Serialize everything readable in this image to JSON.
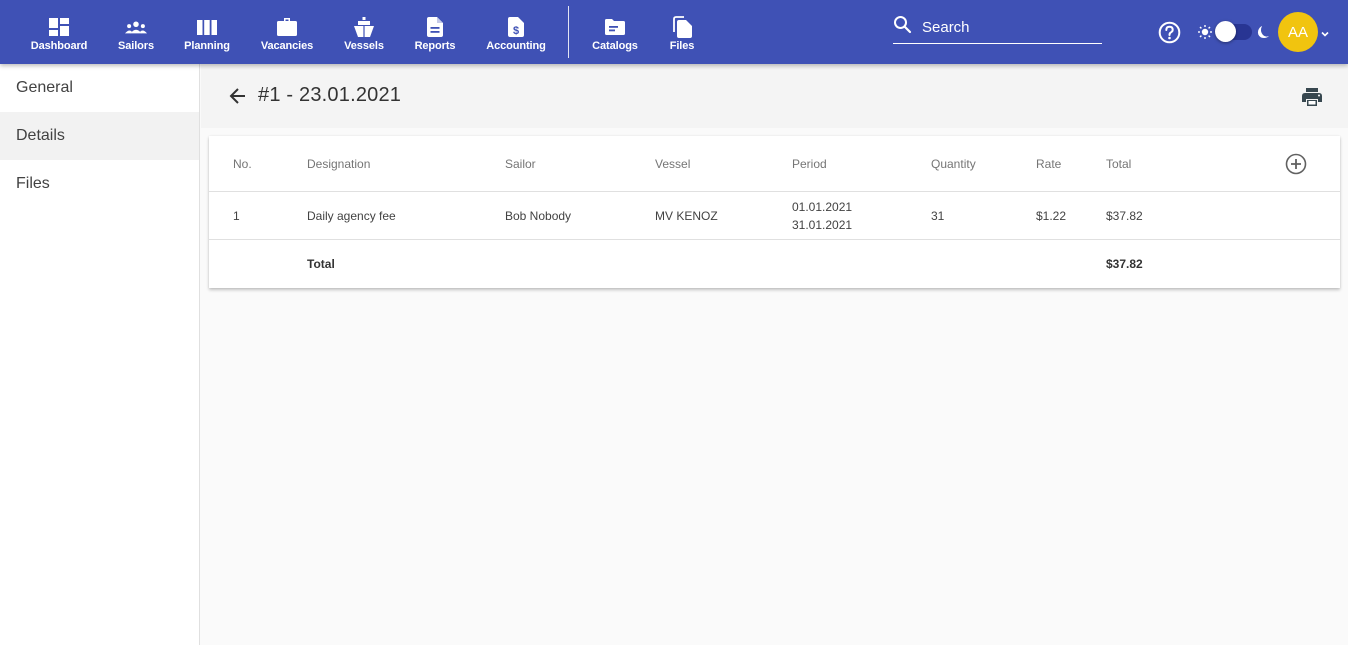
{
  "nav": {
    "items": [
      {
        "label": "Dashboard",
        "icon": "dashboard-icon"
      },
      {
        "label": "Sailors",
        "icon": "people-icon"
      },
      {
        "label": "Planning",
        "icon": "columns-icon"
      },
      {
        "label": "Vacancies",
        "icon": "briefcase-icon"
      },
      {
        "label": "Vessels",
        "icon": "ship-icon"
      },
      {
        "label": "Reports",
        "icon": "document-icon"
      },
      {
        "label": "Accounting",
        "icon": "invoice-dollar-icon"
      },
      {
        "label": "Catalogs",
        "icon": "folder-icon"
      },
      {
        "label": "Files",
        "icon": "files-icon"
      }
    ],
    "search_placeholder": "Search",
    "avatar_initials": "AA",
    "theme_toggle": "light"
  },
  "colors": {
    "primary": "#3f51b5",
    "avatar": "#f1c40f",
    "toggle_track": "#283593"
  },
  "sidebar": {
    "items": [
      {
        "label": "General",
        "active": false
      },
      {
        "label": "Details",
        "active": true
      },
      {
        "label": "Files",
        "active": false
      }
    ]
  },
  "page": {
    "title": "#1 - 23.01.2021"
  },
  "table": {
    "columns": [
      "No.",
      "Designation",
      "Sailor",
      "Vessel",
      "Period",
      "Quantity",
      "Rate",
      "Total"
    ],
    "rows": [
      {
        "no": "1",
        "designation": "Daily agency fee",
        "sailor": "Bob Nobody",
        "vessel": "MV KENOZ",
        "period_start": "01.01.2021",
        "period_end": "31.01.2021",
        "quantity": "31",
        "rate": "$1.22",
        "total": "$37.82"
      }
    ],
    "footer": {
      "label": "Total",
      "total": "$37.82"
    }
  }
}
